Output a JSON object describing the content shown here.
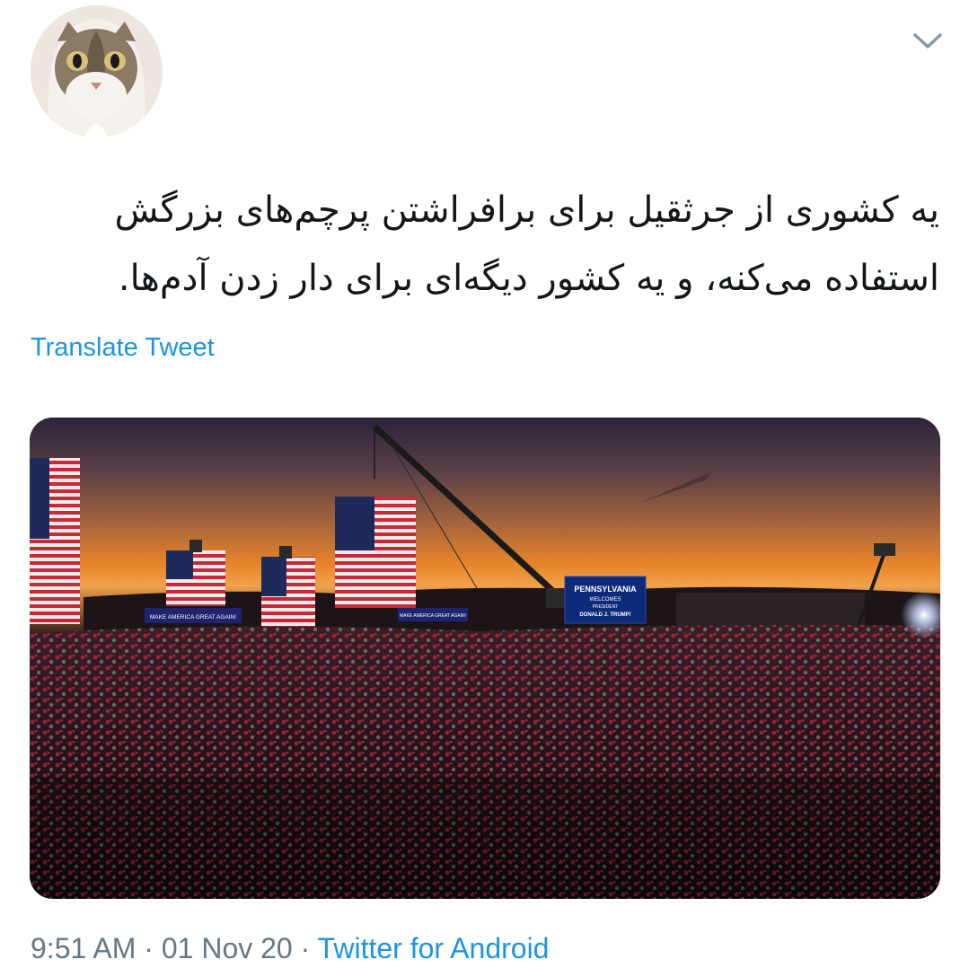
{
  "tweet": {
    "text_line1": "یه کشوری از جرثقیل برای برافراشتن پرچم‌های بزرگش",
    "text_line2": "استفاده می‌کنه، و یه کشور دیگه‌ای برای دار زدن آدم‌ها.",
    "translate_label": "Translate Tweet",
    "time": "9:51 AM",
    "date": "01 Nov 20",
    "separator": "·",
    "source": "Twitter for Android"
  },
  "media": {
    "banner_left": "MAKE AMERICA GREAT AGAIN!",
    "banner_mid": "MAKE AMERICA GREAT AGAIN!",
    "screen_line1": "PENNSYLVANIA",
    "screen_line2": "WELCOMES",
    "screen_line3": "PRESIDENT",
    "screen_line4": "DONALD J. TRUMP!"
  },
  "icons": {
    "menu": "chevron-down-icon",
    "avatar": "cat-avatar"
  },
  "colors": {
    "link": "#1b95e0",
    "meta": "#657786",
    "text": "#14171a"
  }
}
